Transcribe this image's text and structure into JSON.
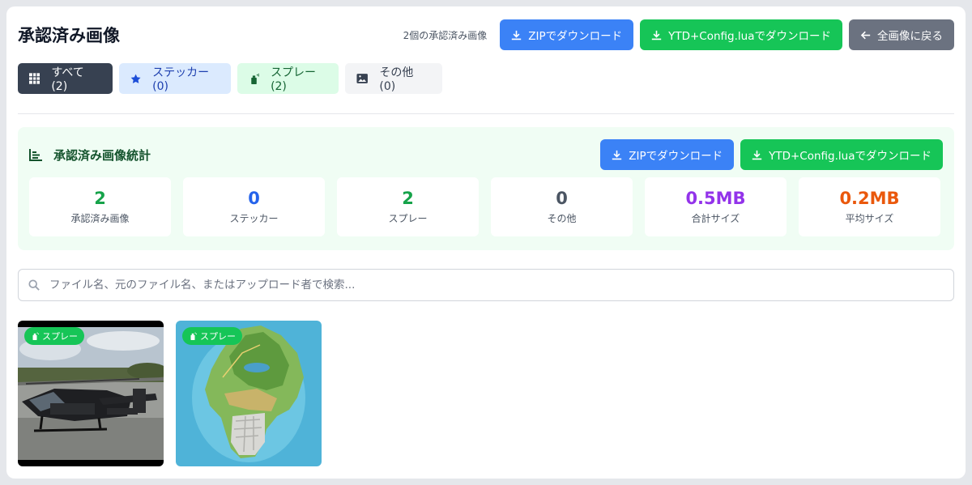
{
  "header": {
    "title": "承認済み画像",
    "count_text": "2個の承認済み画像",
    "zip_button": "ZIPでダウンロード",
    "ytd_button": "YTD+Config.luaでダウンロード",
    "back_button": "全画像に戻る"
  },
  "tabs": [
    {
      "label": "すべて (2)",
      "icon": "grid-icon"
    },
    {
      "label": "ステッカー (0)",
      "icon": "star-icon"
    },
    {
      "label": "スプレー (2)",
      "icon": "spray-can-icon"
    },
    {
      "label": "その他 (0)",
      "icon": "image-icon"
    }
  ],
  "stats": {
    "title": "承認済み画像統計",
    "zip_button": "ZIPでダウンロード",
    "ytd_button": "YTD+Config.luaでダウンロード",
    "cards": [
      {
        "value": "2",
        "label": "承認済み画像",
        "color": "#16a34a"
      },
      {
        "value": "0",
        "label": "ステッカー",
        "color": "#2563eb"
      },
      {
        "value": "2",
        "label": "スプレー",
        "color": "#16a34a"
      },
      {
        "value": "0",
        "label": "その他",
        "color": "#4b5563"
      },
      {
        "value": "0.5MB",
        "label": "合計サイズ",
        "color": "#9333ea"
      },
      {
        "value": "0.2MB",
        "label": "平均サイズ",
        "color": "#ea580c"
      }
    ]
  },
  "search": {
    "placeholder": "ファイル名、元のファイル名、またはアップロード者で検索...",
    "value": ""
  },
  "images": [
    {
      "badge": "スプレー",
      "subject": "police-helicopter"
    },
    {
      "badge": "スプレー",
      "subject": "island-map"
    }
  ],
  "colors": {
    "blue": "#3b82f6",
    "green": "#16c557",
    "gray": "#6b7280",
    "stats_bg": "#f0fdf4"
  }
}
